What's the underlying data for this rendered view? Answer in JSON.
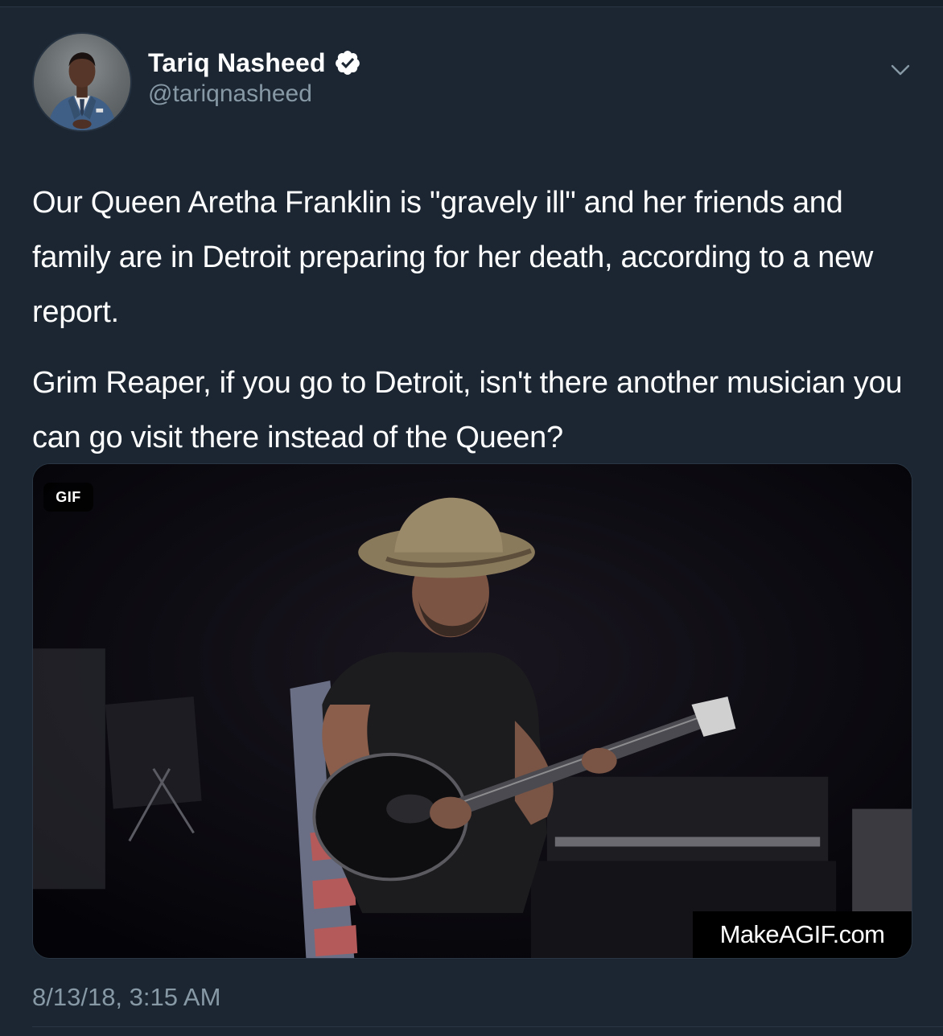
{
  "tweet": {
    "author": {
      "display_name": "Tariq Nasheed",
      "handle": "@tariqnasheed",
      "verified": true,
      "avatar_icon": "profile-photo"
    },
    "paragraphs": [
      "Our Queen Aretha Franklin is \"gravely ill\" and her friends and family are in Detroit preparing for her death, according to a new report.",
      "Grim Reaper, if you go to Detroit, isn't there another musician you can go visit there instead of the Queen?"
    ],
    "media": {
      "badge": "GIF",
      "watermark": "MakeAGIF.com"
    },
    "timestamp": "8/13/18, 3:15 AM"
  },
  "theme": {
    "background": "#1b2632",
    "text": "#ffffff",
    "muted": "#8899a6",
    "verified_badge": "#ffffff"
  }
}
